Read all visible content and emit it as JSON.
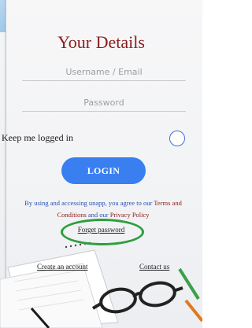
{
  "header": {
    "title": "Your Details"
  },
  "form": {
    "username_placeholder": "Username / Email",
    "password_placeholder": "Password",
    "keep_logged_in_label": "Keep me logged in",
    "login_button_label": "LOGIN"
  },
  "terms": {
    "prefix": "By using and accessing unapp, you agree to our ",
    "link1": "Terms and Conditions",
    "middle": " and our ",
    "link2": "Privacy Policy"
  },
  "links": {
    "forgot_password": "Forget password",
    "create_account": "Create an account",
    "contact_us": "Contact us"
  },
  "colors": {
    "title": "#8b1c1c",
    "accent": "#3a7ff0",
    "highlight_ellipse": "#2e9e3e",
    "top_bar": "#a7cdec"
  }
}
